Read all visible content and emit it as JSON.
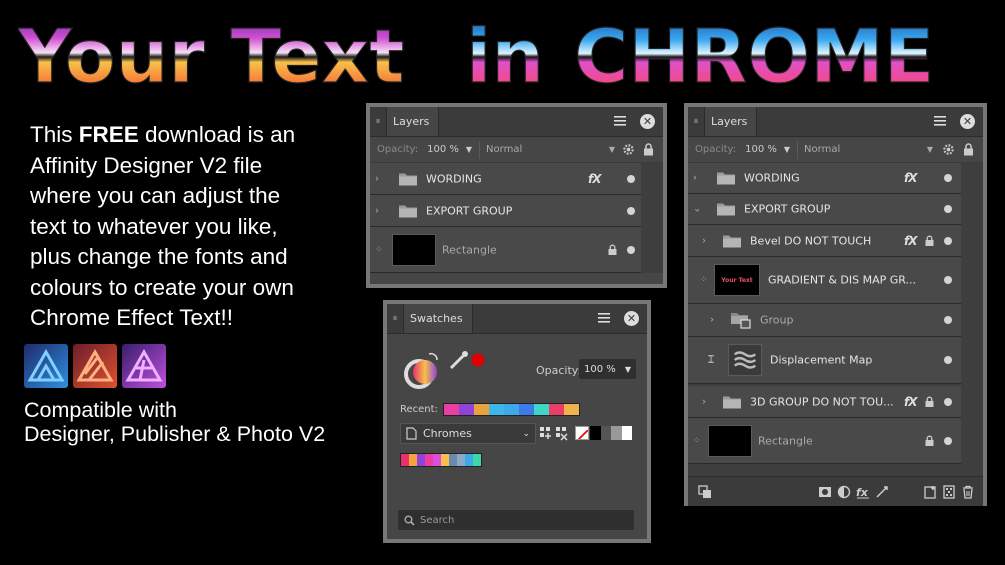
{
  "title": {
    "part1": "Your Text",
    "part2": "in",
    "part3": "CHROME"
  },
  "promo": {
    "line1_pre": "This ",
    "line1_bold": "FREE",
    "line1_post": " download is an",
    "line2": "Affinity Designer V2 file",
    "line3": "where you can adjust the",
    "line4": "text to whatever you like,",
    "line5": "plus change the fonts and",
    "line6": "colours to create your own",
    "line7": "Chrome Effect Text!!"
  },
  "compat": {
    "line1": "Compatible with",
    "line2": "Designer, Publisher & Photo V2"
  },
  "icons": [
    "affinity-designer-icon",
    "affinity-publisher-icon",
    "affinity-photo-icon"
  ],
  "layers_small": {
    "tab": "Layers",
    "opacity_label": "Opacity:",
    "opacity_value": "100 %",
    "blend_mode": "Normal",
    "rows": [
      {
        "name": "WORDING",
        "fx": "fX"
      },
      {
        "name": "EXPORT GROUP"
      },
      {
        "name": "Rectangle"
      }
    ]
  },
  "swatches": {
    "tab": "Swatches",
    "opacity_label": "Opacity:",
    "opacity_value": "100 %",
    "recent_label": "Recent:",
    "palette": "Chromes",
    "search_placeholder": "Search",
    "recent_colors": [
      "#e83fa0",
      "#8e44d6",
      "#e8a33f",
      "#3fb6e8",
      "#3fa8e8",
      "#3f7be8",
      "#3fd6c8",
      "#e83f6a",
      "#f0b24a"
    ],
    "mono_colors": [
      "#ffffff",
      "#000000",
      "#555555",
      "#999999",
      "#ffffff"
    ]
  },
  "layers_large": {
    "tab": "Layers",
    "opacity_label": "Opacity:",
    "opacity_value": "100 %",
    "blend_mode": "Normal",
    "rows": [
      {
        "name": "WORDING",
        "fx": "fX"
      },
      {
        "name": "EXPORT GROUP"
      },
      {
        "name": "Bevel DO NOT TOUCH",
        "fx": "fX"
      },
      {
        "name": "GRADIENT & DIS MAP GR...",
        "thumb_text": "Your Text"
      },
      {
        "name": "Group"
      },
      {
        "name": "Displacement Map"
      },
      {
        "name": "3D GROUP DO NOT TOU...",
        "fx": "fX"
      },
      {
        "name": "Rectangle"
      }
    ]
  },
  "colors": {
    "chrome_top": "#d94fd9",
    "chrome_mid": "#f7a23a",
    "chrome_bottom": "#e8306a",
    "chrome_blue": "#3aa8f0",
    "panel_bg": "#464646",
    "panel_border": "#777777"
  }
}
